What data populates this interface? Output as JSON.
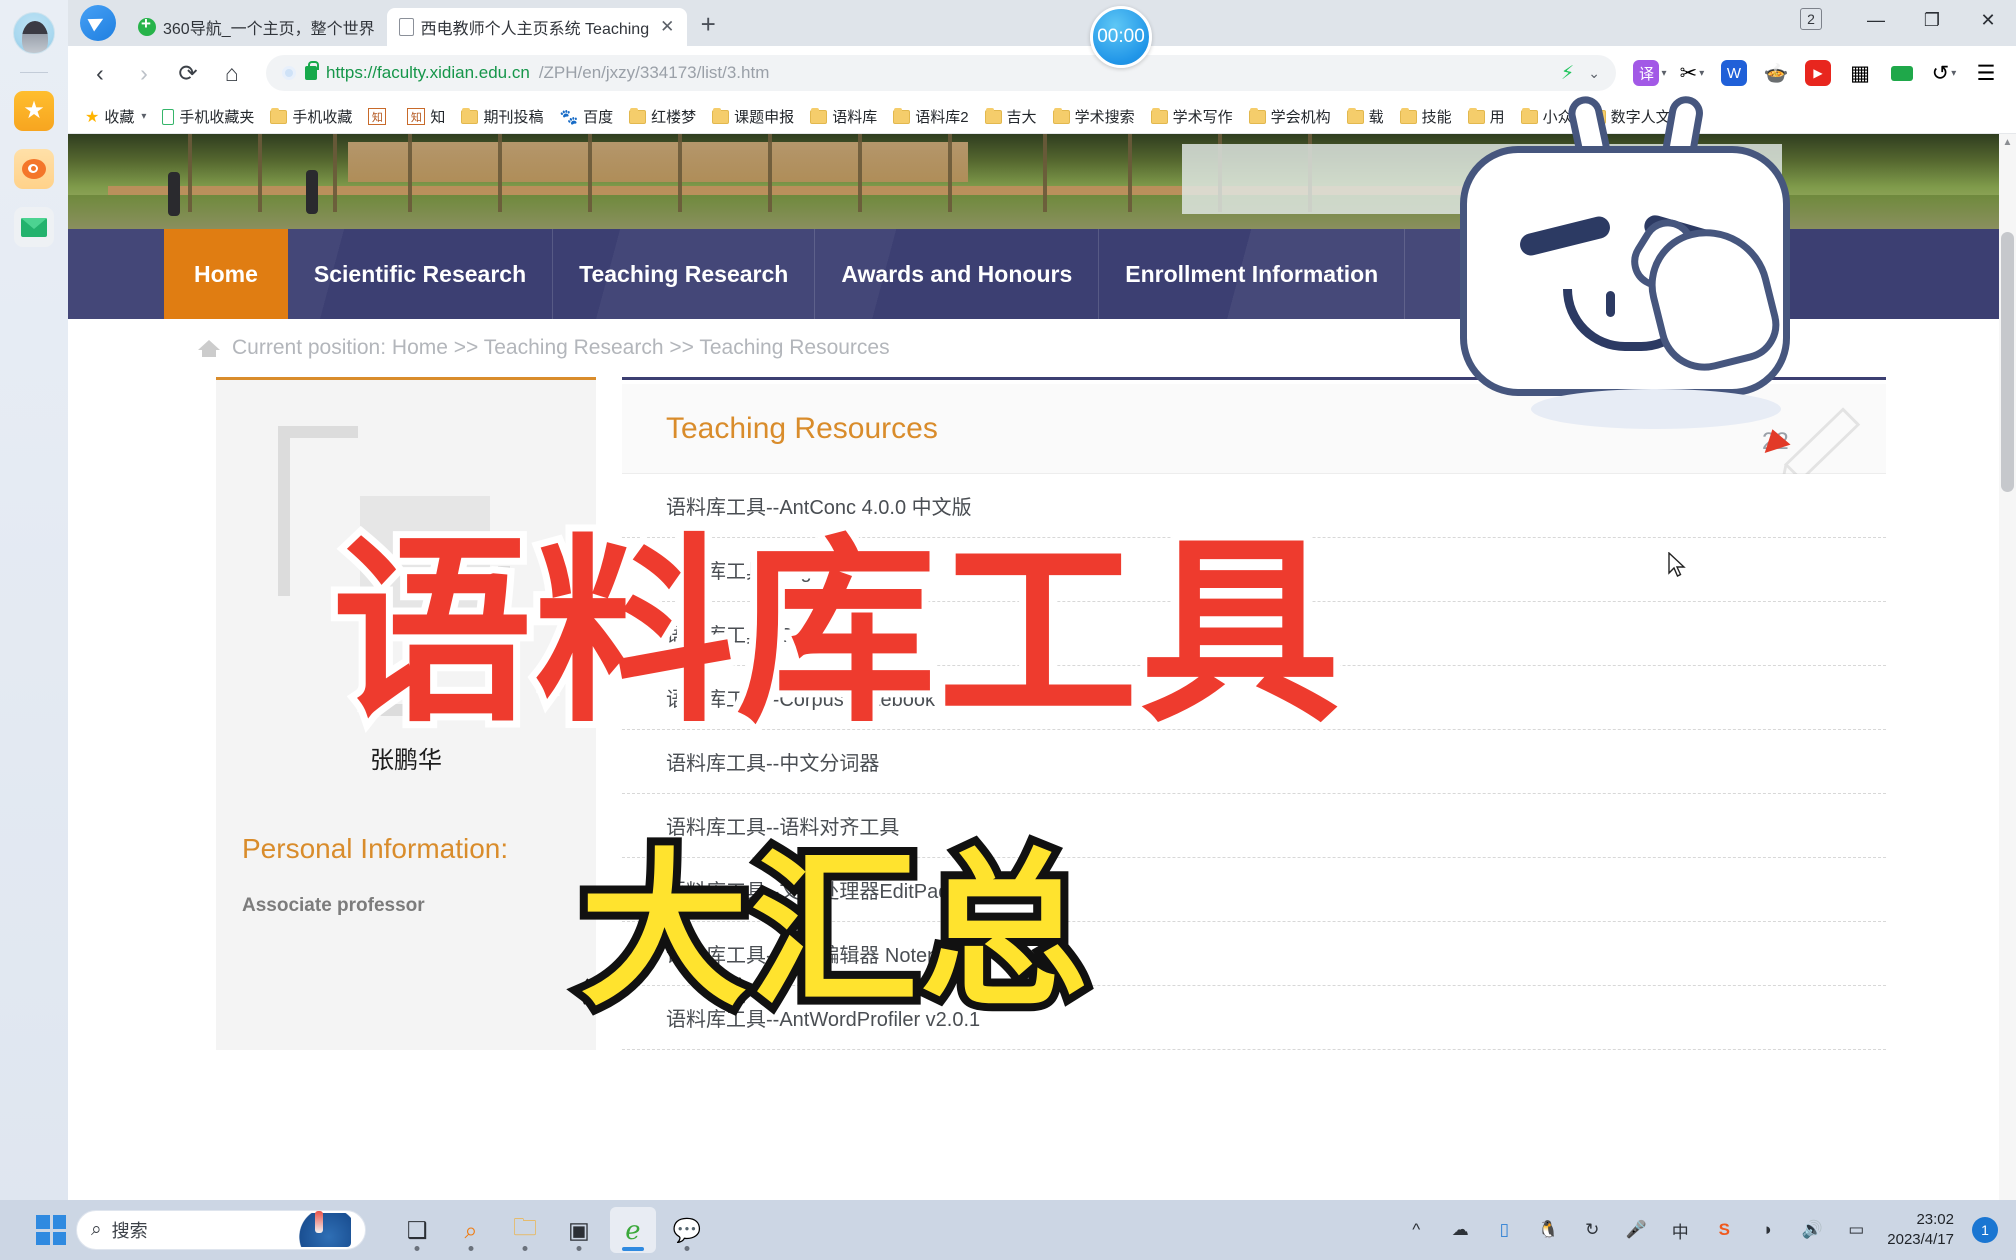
{
  "browser": {
    "tabs": [
      {
        "title": "360导航_一个主页，整个世界",
        "favicon": "360-icon",
        "active": false
      },
      {
        "title": "西电教师个人主页系统 Teaching",
        "favicon": "document-icon",
        "active": true
      }
    ],
    "new_tab_label": "+",
    "window": {
      "tab_count": "2",
      "minimize": "—",
      "restore": "❐",
      "close": "✕"
    },
    "nav": {
      "back": "‹",
      "forward": "›",
      "reload": "⟳",
      "home": "⌂"
    },
    "address": {
      "host": "https://faculty.xidian.edu.cn",
      "path": "/ZPH/en/jxzy/334173/list/3.htm",
      "lock": "lock-icon",
      "bolt": "⚡",
      "chevron": "⌄"
    },
    "timer": "00:00",
    "extensions": [
      {
        "name": "translate-extension",
        "glyph": "译",
        "color": "#a259e6"
      },
      {
        "name": "screenshot-extension",
        "glyph": "✂",
        "color": "#ffffff"
      },
      {
        "name": "wps-extension",
        "glyph": "W",
        "color": "#2060d8"
      },
      {
        "name": "fruit-extension",
        "glyph": "🍲",
        "color": "#ffffff"
      },
      {
        "name": "youtube-extension",
        "glyph": "▶",
        "color": "#e8261e"
      },
      {
        "name": "apps-grid-extension",
        "glyph": "▦",
        "color": "#34383e"
      },
      {
        "name": "battery-extension",
        "glyph": "▬",
        "color": "#1fa84a"
      },
      {
        "name": "undo-extension",
        "glyph": "↺",
        "color": "#34383e"
      },
      {
        "name": "menu-extension",
        "glyph": "☰",
        "color": "#34383e"
      }
    ],
    "bookmarks": [
      {
        "label": "收藏",
        "icon": "star-icon"
      },
      {
        "label": "手机收藏夹",
        "icon": "phone-icon"
      },
      {
        "label": "手机收藏",
        "icon": "folder-icon"
      },
      {
        "label": "",
        "icon": "zhi-icon"
      },
      {
        "label": "知",
        "icon": "zhi-icon"
      },
      {
        "label": "期刊投稿",
        "icon": "folder-icon"
      },
      {
        "label": "百度",
        "icon": "baidu-icon"
      },
      {
        "label": "红楼梦",
        "icon": "folder-icon"
      },
      {
        "label": "课题申报",
        "icon": "folder-icon"
      },
      {
        "label": "语料库",
        "icon": "folder-icon"
      },
      {
        "label": "语料库2",
        "icon": "folder-icon"
      },
      {
        "label": "吉大",
        "icon": "folder-icon"
      },
      {
        "label": "学术搜索",
        "icon": "folder-icon"
      },
      {
        "label": "学术写作",
        "icon": "folder-icon"
      },
      {
        "label": "学会机构",
        "icon": "folder-icon"
      },
      {
        "label": "载",
        "icon": "folder-icon"
      },
      {
        "label": "技能",
        "icon": "folder-icon"
      },
      {
        "label": "用",
        "icon": "folder-icon"
      },
      {
        "label": "小众",
        "icon": "folder-icon"
      },
      {
        "label": "数字人文",
        "icon": "folder-icon"
      }
    ],
    "bookmarks_overflow": "»"
  },
  "page": {
    "nav_items": [
      {
        "label": "Home",
        "active": true
      },
      {
        "label": "Scientific Research",
        "active": false
      },
      {
        "label": "Teaching Research",
        "active": false
      },
      {
        "label": "Awards and Honours",
        "active": false
      },
      {
        "label": "Enrollment Information",
        "active": false
      }
    ],
    "breadcrumb": "Current position: Home >> Teaching Research >> Teaching Resources",
    "profile": {
      "name": "张鹏华",
      "section_title": "Personal Information:",
      "position": "Associate professor"
    },
    "panel_title": "Teaching Resources",
    "list_items": [
      "语料库工具--AntConc 4.0.0 中文版",
      "语料库工具--TagAnt",
      "语料库工具--SPSS",
      "语料库工具--Corpus Notebook",
      "语料库工具--中文分词器",
      "语料库工具--语料对齐工具",
      "语料库工具--文本处理器EditPad Pro",
      "语料库工具--文本编辑器 Notepad",
      "语料库工具--AntWordProfiler v2.0.1"
    ],
    "visitor_count": "22",
    "colors": {
      "nav_bg": "#3c3f72",
      "nav_active": "#e07d12",
      "accent_orange": "#d98c2b"
    }
  },
  "overlay": {
    "headline_red": "语料库工具",
    "headline_yellow": "大汇总"
  },
  "taskbar": {
    "start": "start-button",
    "search_placeholder": "搜索",
    "apps": [
      {
        "name": "task-view-app"
      },
      {
        "name": "search-everything-app"
      },
      {
        "name": "file-explorer-app"
      },
      {
        "name": "notes-app"
      },
      {
        "name": "edge-browser-app",
        "active": true
      },
      {
        "name": "wechat-app"
      }
    ],
    "tray": [
      {
        "name": "show-hidden-icons",
        "glyph": "^"
      },
      {
        "name": "cloud-sync-icon",
        "glyph": "☁"
      },
      {
        "name": "book-icon",
        "glyph": "▯"
      },
      {
        "name": "qq-icon",
        "glyph": "🐧"
      },
      {
        "name": "refresh-icon",
        "glyph": "↻"
      },
      {
        "name": "microphone-icon",
        "glyph": "🎤"
      },
      {
        "name": "ime-icon",
        "glyph": "中"
      },
      {
        "name": "sogou-icon",
        "glyph": "S"
      },
      {
        "name": "wifi-icon",
        "glyph": "◗"
      },
      {
        "name": "volume-icon",
        "glyph": "🔊"
      },
      {
        "name": "battery-icon",
        "glyph": "▭"
      }
    ],
    "time": "23:02",
    "date": "2023/4/17",
    "notification_count": "1"
  }
}
